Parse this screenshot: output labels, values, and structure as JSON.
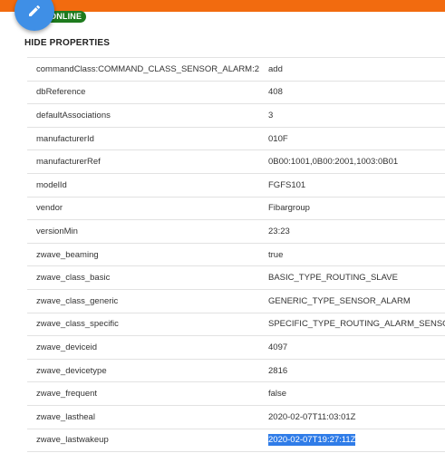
{
  "header": {
    "accent_color": "#f26b0f",
    "edit_button_icon": "pencil-icon",
    "edit_button_color": "#3f8fe6",
    "status_badge": "ONLINE",
    "status_color": "#1e7b1e"
  },
  "properties": {
    "toggle_label": "HIDE PROPERTIES",
    "rows": [
      {
        "key": "commandClass:COMMAND_CLASS_SENSOR_ALARM:2",
        "value": "add"
      },
      {
        "key": "dbReference",
        "value": "408"
      },
      {
        "key": "defaultAssociations",
        "value": "3"
      },
      {
        "key": "manufacturerId",
        "value": "010F"
      },
      {
        "key": "manufacturerRef",
        "value": "0B00:1001,0B00:2001,1003:0B01"
      },
      {
        "key": "modelId",
        "value": "FGFS101"
      },
      {
        "key": "vendor",
        "value": "Fibargroup"
      },
      {
        "key": "versionMin",
        "value": "23:23"
      },
      {
        "key": "zwave_beaming",
        "value": "true"
      },
      {
        "key": "zwave_class_basic",
        "value": "BASIC_TYPE_ROUTING_SLAVE"
      },
      {
        "key": "zwave_class_generic",
        "value": "GENERIC_TYPE_SENSOR_ALARM"
      },
      {
        "key": "zwave_class_specific",
        "value": "SPECIFIC_TYPE_ROUTING_ALARM_SENSOR"
      },
      {
        "key": "zwave_deviceid",
        "value": "4097"
      },
      {
        "key": "zwave_devicetype",
        "value": "2816"
      },
      {
        "key": "zwave_frequent",
        "value": "false"
      },
      {
        "key": "zwave_lastheal",
        "value": "2020-02-07T11:03:01Z"
      },
      {
        "key": "zwave_lastwakeup",
        "value": "2020-02-07T19:27:11Z",
        "selected": true
      }
    ]
  }
}
